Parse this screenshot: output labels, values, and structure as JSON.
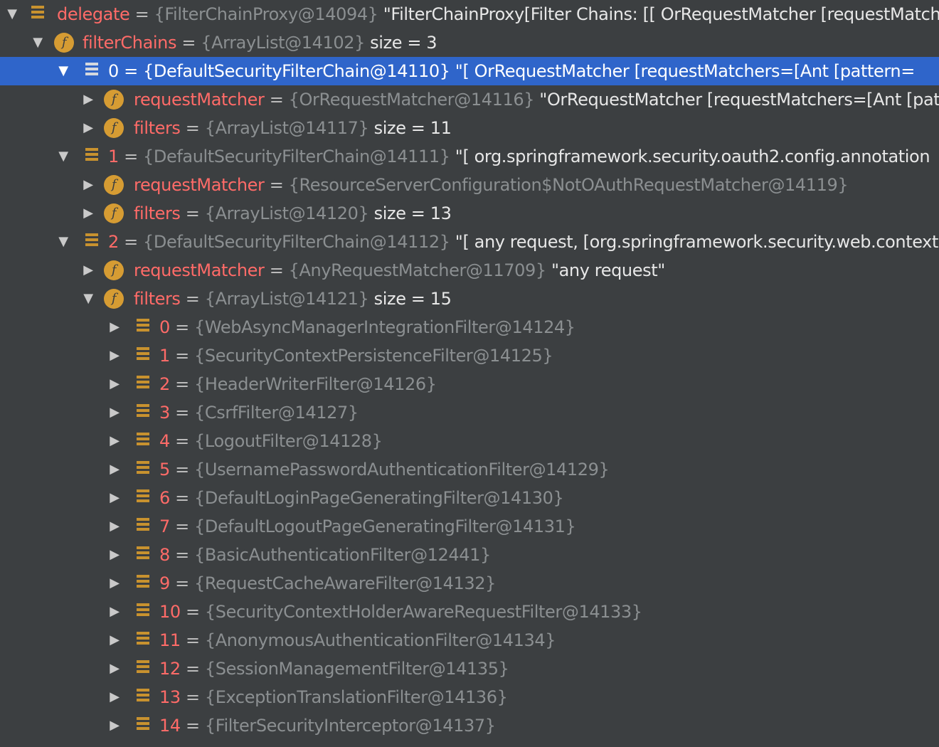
{
  "rows": [
    {
      "toggle": "open",
      "icon": "list-icon",
      "name": "delegate",
      "eq": " = ",
      "type": "{FilterChainProxy@14094}",
      "value": " \"FilterChainProxy[Filter Chains: [[ OrRequestMatcher [requestMatchers=[Ant [pattern="
    },
    {
      "toggle": "open",
      "icon": "field-icon",
      "name": "filterChains",
      "eq": " = ",
      "type": "{ArrayList@14102}",
      "value": "  size = 3"
    },
    {
      "toggle": "open",
      "icon": "list-icon",
      "name": "0",
      "eq": " = ",
      "type": "{DefaultSecurityFilterChain@14110}",
      "value": " \"[ OrRequestMatcher [requestMatchers=[Ant [pattern=",
      "selected": true
    },
    {
      "toggle": "closed",
      "icon": "field-icon",
      "name": "requestMatcher",
      "eq": " = ",
      "type": "{OrRequestMatcher@14116}",
      "value": " \"OrRequestMatcher [requestMatchers=[Ant [pattern="
    },
    {
      "toggle": "closed",
      "icon": "field-icon",
      "name": "filters",
      "eq": " = ",
      "type": "{ArrayList@14117}",
      "value": "  size = 11"
    },
    {
      "toggle": "open",
      "icon": "list-icon",
      "name": "1",
      "eq": " = ",
      "type": "{DefaultSecurityFilterChain@14111}",
      "value": " \"[ org.springframework.security.oauth2.config.annotation"
    },
    {
      "toggle": "closed",
      "icon": "field-icon",
      "name": "requestMatcher",
      "eq": " = ",
      "type": "{ResourceServerConfiguration$NotOAuthRequestMatcher@14119}",
      "value": ""
    },
    {
      "toggle": "closed",
      "icon": "field-icon",
      "name": "filters",
      "eq": " = ",
      "type": "{ArrayList@14120}",
      "value": "  size = 13"
    },
    {
      "toggle": "open",
      "icon": "list-icon",
      "name": "2",
      "eq": " = ",
      "type": "{DefaultSecurityFilterChain@14112}",
      "value": " \"[ any request, [org.springframework.security.web.context"
    },
    {
      "toggle": "closed",
      "icon": "field-icon",
      "name": "requestMatcher",
      "eq": " = ",
      "type": "{AnyRequestMatcher@11709}",
      "value": " \"any request\""
    },
    {
      "toggle": "open",
      "icon": "field-icon",
      "name": "filters",
      "eq": " = ",
      "type": "{ArrayList@14121}",
      "value": "  size = 15"
    },
    {
      "toggle": "closed",
      "icon": "list-icon",
      "name": "0",
      "eq": " = ",
      "type": "{WebAsyncManagerIntegrationFilter@14124}",
      "value": ""
    },
    {
      "toggle": "closed",
      "icon": "list-icon",
      "name": "1",
      "eq": " = ",
      "type": "{SecurityContextPersistenceFilter@14125}",
      "value": ""
    },
    {
      "toggle": "closed",
      "icon": "list-icon",
      "name": "2",
      "eq": " = ",
      "type": "{HeaderWriterFilter@14126}",
      "value": ""
    },
    {
      "toggle": "closed",
      "icon": "list-icon",
      "name": "3",
      "eq": " = ",
      "type": "{CsrfFilter@14127}",
      "value": ""
    },
    {
      "toggle": "closed",
      "icon": "list-icon",
      "name": "4",
      "eq": " = ",
      "type": "{LogoutFilter@14128}",
      "value": ""
    },
    {
      "toggle": "closed",
      "icon": "list-icon",
      "name": "5",
      "eq": " = ",
      "type": "{UsernamePasswordAuthenticationFilter@14129}",
      "value": ""
    },
    {
      "toggle": "closed",
      "icon": "list-icon",
      "name": "6",
      "eq": " = ",
      "type": "{DefaultLoginPageGeneratingFilter@14130}",
      "value": ""
    },
    {
      "toggle": "closed",
      "icon": "list-icon",
      "name": "7",
      "eq": " = ",
      "type": "{DefaultLogoutPageGeneratingFilter@14131}",
      "value": ""
    },
    {
      "toggle": "closed",
      "icon": "list-icon",
      "name": "8",
      "eq": " = ",
      "type": "{BasicAuthenticationFilter@12441}",
      "value": ""
    },
    {
      "toggle": "closed",
      "icon": "list-icon",
      "name": "9",
      "eq": " = ",
      "type": "{RequestCacheAwareFilter@14132}",
      "value": ""
    },
    {
      "toggle": "closed",
      "icon": "list-icon",
      "name": "10",
      "eq": " = ",
      "type": "{SecurityContextHolderAwareRequestFilter@14133}",
      "value": ""
    },
    {
      "toggle": "closed",
      "icon": "list-icon",
      "name": "11",
      "eq": " = ",
      "type": "{AnonymousAuthenticationFilter@14134}",
      "value": ""
    },
    {
      "toggle": "closed",
      "icon": "list-icon",
      "name": "12",
      "eq": " = ",
      "type": "{SessionManagementFilter@14135}",
      "value": ""
    },
    {
      "toggle": "closed",
      "icon": "list-icon",
      "name": "13",
      "eq": " = ",
      "type": "{ExceptionTranslationFilter@14136}",
      "value": ""
    },
    {
      "toggle": "closed",
      "icon": "list-icon",
      "name": "14",
      "eq": " = ",
      "type": "{FilterSecurityInterceptor@14137}",
      "value": ""
    }
  ],
  "colors": {
    "background": "#3c3f41",
    "selection": "#2f65ca",
    "name": "#ff6b68",
    "type": "#8b8f91",
    "value": "#e7e7e7",
    "icon": "#c8922f"
  }
}
